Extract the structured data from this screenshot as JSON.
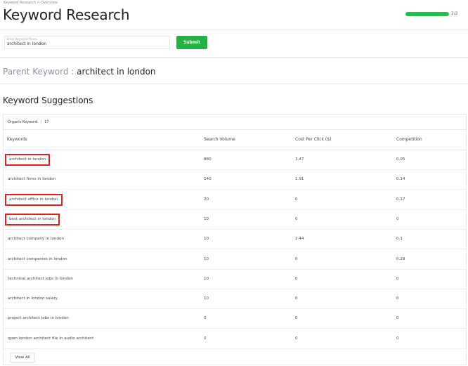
{
  "breadcrumb": "Keyword Research > Overview",
  "page_title": "Keyword Research",
  "progress": {
    "fraction": 1.0,
    "text": "2/2"
  },
  "search": {
    "placeholder": "Enter Keyword Phase",
    "value": "architect in london",
    "submit_label": "Submit"
  },
  "parent_keyword": {
    "label": "Parent Keyword :",
    "value": "architect in london"
  },
  "suggestions": {
    "title": "Keyword Suggestions",
    "organic_label": "Organic Keyword",
    "organic_count": "17",
    "columns": [
      "Keywords",
      "Search Volume",
      "Cost Per Click ($)",
      "Competition"
    ],
    "rows": [
      {
        "keyword": "architect in london",
        "volume": "880",
        "cpc": "3.47",
        "competition": "0.05",
        "highlighted": true
      },
      {
        "keyword": "architect firms in london",
        "volume": "140",
        "cpc": "1.91",
        "competition": "0.14",
        "highlighted": false
      },
      {
        "keyword": "architect office in london",
        "volume": "20",
        "cpc": "0",
        "competition": "0.17",
        "highlighted": true
      },
      {
        "keyword": "best architect in london",
        "volume": "10",
        "cpc": "0",
        "competition": "0",
        "highlighted": true
      },
      {
        "keyword": "architect company in london",
        "volume": "10",
        "cpc": "2.44",
        "competition": "0.1",
        "highlighted": false
      },
      {
        "keyword": "architect companies in london",
        "volume": "10",
        "cpc": "0",
        "competition": "0.29",
        "highlighted": false
      },
      {
        "keyword": "technical architect jobs in london",
        "volume": "10",
        "cpc": "0",
        "competition": "0",
        "highlighted": false
      },
      {
        "keyword": "architect in london salary",
        "volume": "10",
        "cpc": "0",
        "competition": "0",
        "highlighted": false
      },
      {
        "keyword": "project architect jobs in london",
        "volume": "0",
        "cpc": "0",
        "competition": "0",
        "highlighted": false
      },
      {
        "keyword": "open london architect file in audio architect",
        "volume": "0",
        "cpc": "0",
        "competition": "0",
        "highlighted": false
      }
    ],
    "view_all_label": "View All"
  },
  "colors": {
    "accent_green": "#22b443",
    "progress_green": "#22c04a",
    "highlight_red": "#e02020",
    "parent_label": "#8a93a6"
  }
}
